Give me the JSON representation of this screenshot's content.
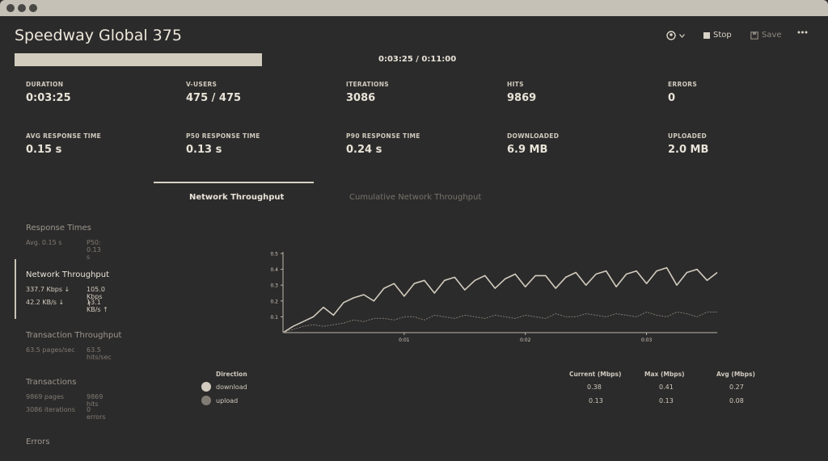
{
  "window": {
    "controls": [
      "close",
      "minimize",
      "maximize"
    ]
  },
  "header": {
    "title": "Speedway Global 375",
    "user_icon": "user-icon",
    "stop_label": "Stop",
    "save_label": "Save",
    "more_icon": "ellipsis-icon"
  },
  "progress": {
    "fraction": 0.31,
    "time": "0:03:25 / 0:11:00"
  },
  "stats": [
    {
      "label": "DURATION",
      "value": "0:03:25"
    },
    {
      "label": "V-USERS",
      "value": "475 / 475"
    },
    {
      "label": "ITERATIONS",
      "value": "3086"
    },
    {
      "label": "HITS",
      "value": "9869"
    },
    {
      "label": "ERRORS",
      "value": "0"
    },
    {
      "label": "AVG RESPONSE TIME",
      "value": "0.15 s"
    },
    {
      "label": "P50 RESPONSE TIME",
      "value": "0.13 s"
    },
    {
      "label": "P90 RESPONSE TIME",
      "value": "0.24 s"
    },
    {
      "label": "DOWNLOADED",
      "value": "6.9 MB"
    },
    {
      "label": "UPLOADED",
      "value": "2.0 MB"
    }
  ],
  "tabs": [
    {
      "label": "Network Throughput",
      "active": true
    },
    {
      "label": "Cumulative Network Throughput",
      "active": false
    }
  ],
  "sidebar": {
    "response_times": {
      "title": "Response Times",
      "a": "Avg. 0.15 s",
      "b": "P50: 0.13 s"
    },
    "network": {
      "title": "Network Throughput",
      "a": "337.7 Kbps ↓",
      "b": "105.0 Kbps ↑",
      "c": "42.2 KB/s ↓",
      "d": "13.1 KB/s ↑"
    },
    "transaction": {
      "title": "Transaction Throughput",
      "a": "63.5 pages/sec",
      "b": "63.5 hits/sec"
    },
    "transactions": {
      "title": "Transactions",
      "a": "9869 pages",
      "b": "9869 hits",
      "c": "3086 iterations",
      "d": "0 errors"
    },
    "errors": {
      "title": "Errors"
    }
  },
  "chart_data": {
    "type": "line",
    "x_ticks": [
      "0:01",
      "0:02",
      "0:03"
    ],
    "y_ticks": [
      "0.1",
      "0.2",
      "0.3",
      "0.4",
      "0.5"
    ],
    "ylim": [
      0,
      0.5
    ],
    "xlim_seconds": [
      0,
      215
    ],
    "series": [
      {
        "name": "download",
        "color": "#d2ccbf",
        "x": [
          0,
          5,
          10,
          15,
          20,
          25,
          30,
          35,
          40,
          45,
          50,
          55,
          60,
          65,
          70,
          75,
          80,
          85,
          90,
          95,
          100,
          105,
          110,
          115,
          120,
          125,
          130,
          135,
          140,
          145,
          150,
          155,
          160,
          165,
          170,
          175,
          180,
          185,
          190,
          195,
          200,
          205,
          210,
          215
        ],
        "values": [
          0,
          0.04,
          0.07,
          0.1,
          0.16,
          0.11,
          0.19,
          0.22,
          0.24,
          0.2,
          0.28,
          0.31,
          0.23,
          0.31,
          0.33,
          0.25,
          0.33,
          0.35,
          0.27,
          0.33,
          0.36,
          0.28,
          0.34,
          0.37,
          0.29,
          0.36,
          0.36,
          0.28,
          0.35,
          0.38,
          0.3,
          0.37,
          0.39,
          0.29,
          0.37,
          0.39,
          0.31,
          0.39,
          0.41,
          0.3,
          0.38,
          0.4,
          0.33,
          0.38
        ]
      },
      {
        "name": "upload",
        "color": "#807b73",
        "x": [
          0,
          5,
          10,
          15,
          20,
          25,
          30,
          35,
          40,
          45,
          50,
          55,
          60,
          65,
          70,
          75,
          80,
          85,
          90,
          95,
          100,
          105,
          110,
          115,
          120,
          125,
          130,
          135,
          140,
          145,
          150,
          155,
          160,
          165,
          170,
          175,
          180,
          185,
          190,
          195,
          200,
          205,
          210,
          215
        ],
        "values": [
          0,
          0.02,
          0.04,
          0.05,
          0.04,
          0.05,
          0.06,
          0.08,
          0.07,
          0.09,
          0.09,
          0.08,
          0.1,
          0.1,
          0.08,
          0.11,
          0.1,
          0.09,
          0.11,
          0.1,
          0.09,
          0.11,
          0.1,
          0.09,
          0.11,
          0.1,
          0.09,
          0.12,
          0.1,
          0.1,
          0.12,
          0.11,
          0.1,
          0.12,
          0.11,
          0.1,
          0.13,
          0.11,
          0.1,
          0.13,
          0.12,
          0.1,
          0.13,
          0.13
        ]
      }
    ]
  },
  "legend": {
    "headers": {
      "direction": "Direction",
      "current": "Current (Mbps)",
      "max": "Max (Mbps)",
      "avg": "Avg (Mbps)"
    },
    "rows": [
      {
        "name": "download",
        "current": "0.38",
        "max": "0.41",
        "avg": "0.27"
      },
      {
        "name": "upload",
        "current": "0.13",
        "max": "0.13",
        "avg": "0.08"
      }
    ]
  }
}
